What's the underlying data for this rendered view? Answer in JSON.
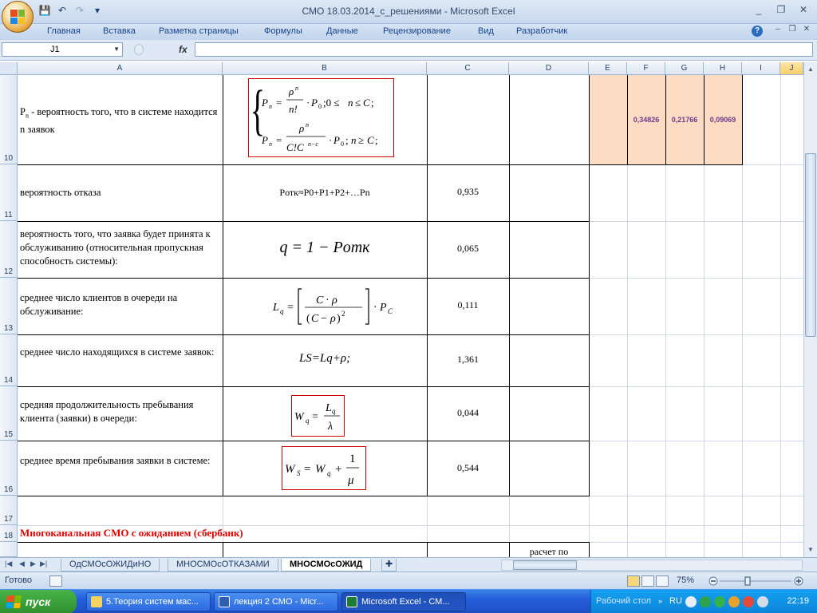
{
  "window": {
    "title": "СМО 18.03.2014_с_решениями - Microsoft Excel",
    "min": "_",
    "max": "❐",
    "close": "✕"
  },
  "ribbon": {
    "tabs": [
      "Главная",
      "Вставка",
      "Разметка страницы",
      "Формулы",
      "Данные",
      "Рецензирование",
      "Вид",
      "Разработчик"
    ],
    "help": "?"
  },
  "formula_bar": {
    "name_box": "J1",
    "fx": "fx",
    "value": ""
  },
  "columns": [
    "A",
    "B",
    "C",
    "D",
    "E",
    "F",
    "G",
    "H",
    "I",
    "J"
  ],
  "rows": [
    "10",
    "11",
    "12",
    "13",
    "14",
    "15",
    "16",
    "17",
    "18"
  ],
  "cells": {
    "a10_sym": "P",
    "a10_sub": "n",
    "a10_text": " - вероятность того, что в системе находится n заявок",
    "a11": "вероятность отказа",
    "a12": "вероятность того, что заявка будет принята к обслуживанию (относительная пропускная способность системы):",
    "a13": "среднее число клиентов в очереди на обслуживание:",
    "a14": "среднее число находящихся в системе заявок:",
    "a15": "средняя продолжительность пребывания клиента (заявки) в очереди:",
    "a16": "среднее время пребывания заявки в системе:",
    "a18": "Многоканальная СМО с ожиданием (сбербанк)",
    "c11": "0,935",
    "c12": "0,065",
    "c13": "0,111",
    "c14": "1,361",
    "c15": "0,044",
    "c16": "0,544",
    "f10": "0,34826",
    "g10": "0,21766",
    "h10": "0,09069",
    "d19": "расчет по"
  },
  "formulas": {
    "b11": "Pотк≈P0+P1+P2+…Pn",
    "b12": "q = 1 − Pотк",
    "b14": "LS=Lq+ρ;"
  },
  "sheets": {
    "tabs": [
      "ОдСМОсОЖИДиНО",
      "МНОСМОсОТКАЗАМИ",
      "МНОСМОсОЖИД"
    ],
    "active": "МНОСМОсОЖИД"
  },
  "status": {
    "text": "Готово",
    "zoom": "75%"
  },
  "taskbar": {
    "start": "пуск",
    "items": [
      "5.Теория систем мас...",
      "лекция 2 СМО - Micr...",
      "Microsoft Excel - СМ..."
    ],
    "desktop": "Рабочий стол",
    "lang": "RU",
    "clock": "22:19"
  }
}
